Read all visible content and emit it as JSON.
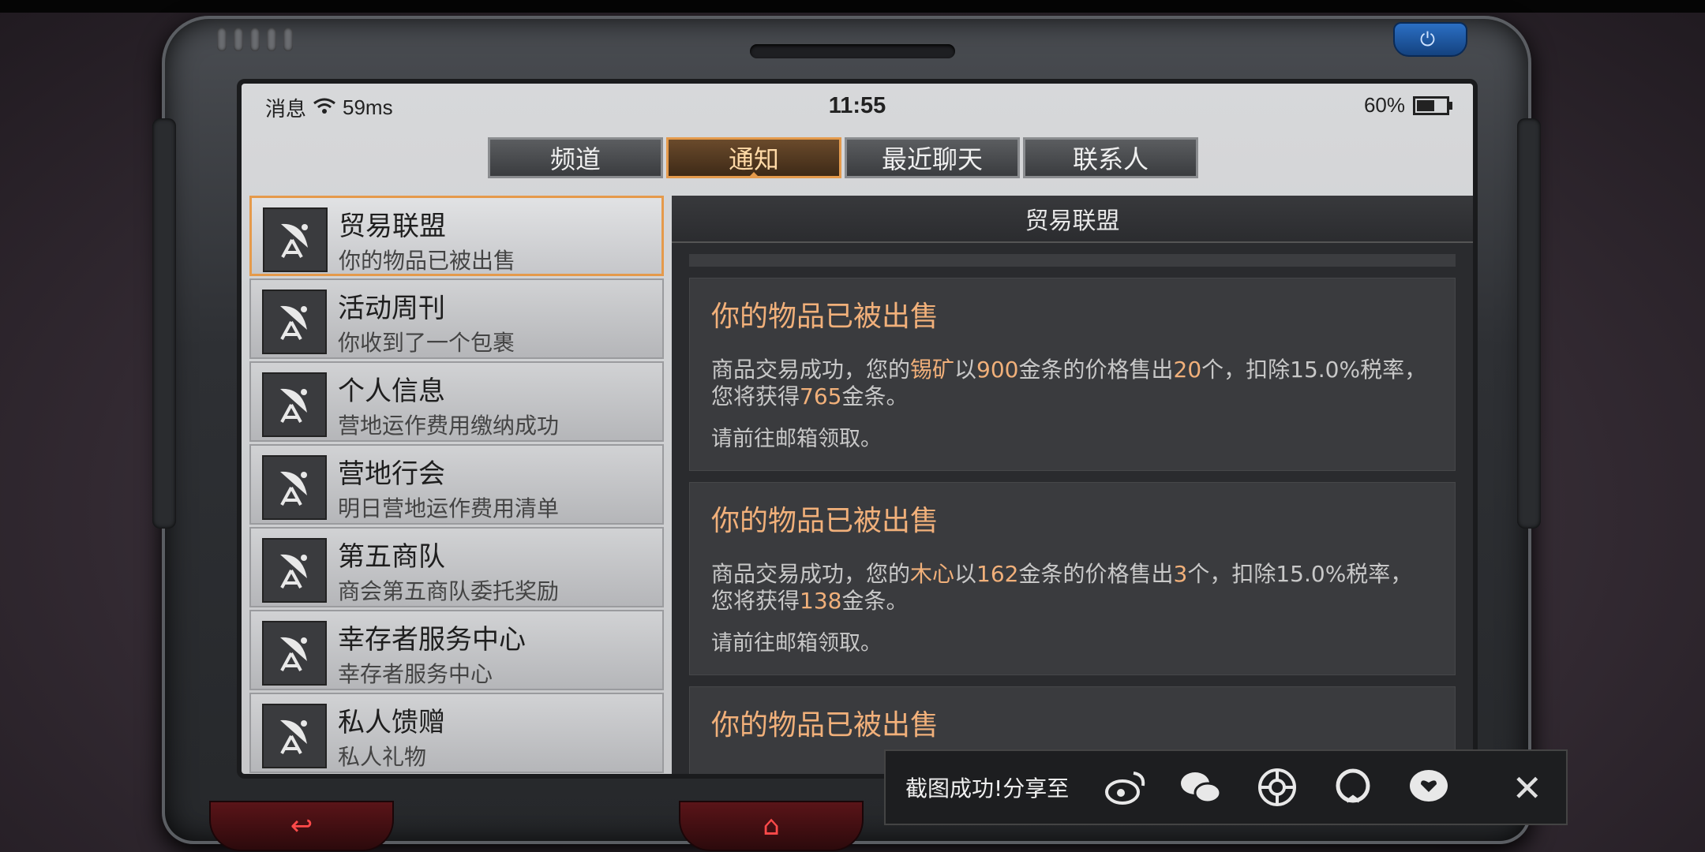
{
  "status": {
    "left_label": "消息",
    "ping": "59ms",
    "time": "11:55",
    "battery_text": "60%",
    "battery_level": 0.6
  },
  "tabs": [
    {
      "label": "频道"
    },
    {
      "label": "通知"
    },
    {
      "label": "最近聊天"
    },
    {
      "label": "联系人"
    }
  ],
  "list": [
    {
      "title": "贸易联盟",
      "subtitle": "你的物品已被出售"
    },
    {
      "title": "活动周刊",
      "subtitle": "你收到了一个包裹"
    },
    {
      "title": "个人信息",
      "subtitle": "营地运作费用缴纳成功"
    },
    {
      "title": "营地行会",
      "subtitle": "明日营地运作费用清单"
    },
    {
      "title": "第五商队",
      "subtitle": "商会第五商队委托奖励"
    },
    {
      "title": "幸存者服务中心",
      "subtitle": "幸存者服务中心"
    },
    {
      "title": "私人馈赠",
      "subtitle": "私人礼物"
    }
  ],
  "detail": {
    "header": "贸易联盟",
    "messages": [
      {
        "title": "你的物品已被出售",
        "b1": "商品交易成功，您的",
        "item": "锡矿",
        "b2": "以",
        "price": "900",
        "b3": "金条的价格售出",
        "qty": "20",
        "b4": "个，扣除15.0%税率，您将获得",
        "total": "765",
        "b5": "金条。",
        "footer": "请前往邮箱领取。"
      },
      {
        "title": "你的物品已被出售",
        "b1": "商品交易成功，您的",
        "item": "木心",
        "b2": "以",
        "price": "162",
        "b3": "金条的价格售出",
        "qty": "3",
        "b4": "个，扣除15.0%税率，您将获得",
        "total": "138",
        "b5": "金条。",
        "footer": "请前往邮箱领取。"
      },
      {
        "title": "你的物品已被出售"
      }
    ]
  },
  "share": {
    "text": "截图成功!分享至",
    "icons": [
      "weibo-icon",
      "wechat-icon",
      "moments-icon",
      "qq-icon",
      "qzone-icon"
    ]
  }
}
